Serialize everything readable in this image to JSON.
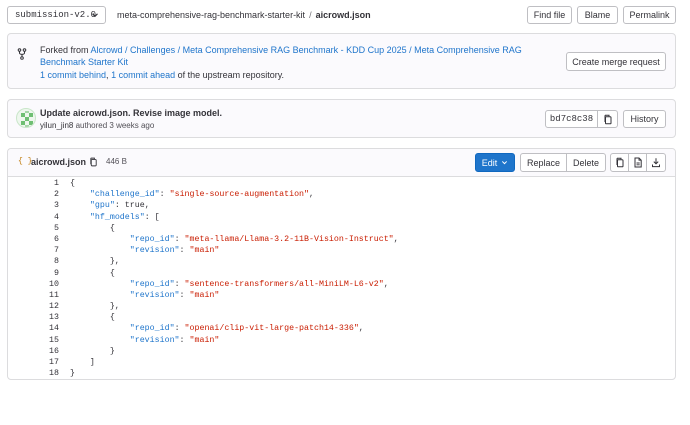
{
  "toolbar": {
    "branch": "submission-v2.0",
    "breadcrumb": {
      "repo": "meta-comprehensive-rag-benchmark-starter-kit",
      "separator": "/",
      "file": "aicrowd.json"
    },
    "find_file_label": "Find file",
    "blame_label": "Blame",
    "permalink_label": "Permalink"
  },
  "fork_notice": {
    "prefix": "Forked from",
    "source_link": "Alcrowd / Challenges / Meta Comprehensive RAG Benchmark - KDD Cup 2025 / Meta Comprehensive RAG Benchmark Starter Kit",
    "behind_link": "1 commit behind",
    "comma": ",",
    "ahead_link": "1 commit ahead",
    "suffix": "of the upstream repository.",
    "merge_button": "Create merge request"
  },
  "commit": {
    "title": "Update aicrowd.json. Revise image model.",
    "author": "yilun_jin8",
    "authored_text": "authored 3 weeks ago",
    "sha": "bd7c8c38",
    "history_label": "History"
  },
  "file": {
    "icon_text": "{ }",
    "name": "aicrowd.json",
    "size": "446 B",
    "edit_label": "Edit",
    "replace_label": "Replace",
    "delete_label": "Delete"
  },
  "code_lines": [
    {
      "n": "1",
      "t": [
        {
          "c": "p",
          "v": "{"
        }
      ]
    },
    {
      "n": "2",
      "t": [
        {
          "c": "p",
          "v": "    "
        },
        {
          "c": "k",
          "v": "\"challenge_id\""
        },
        {
          "c": "p",
          "v": ": "
        },
        {
          "c": "s",
          "v": "\"single-source-augmentation\""
        },
        {
          "c": "p",
          "v": ","
        }
      ]
    },
    {
      "n": "3",
      "t": [
        {
          "c": "p",
          "v": "    "
        },
        {
          "c": "k",
          "v": "\"gpu\""
        },
        {
          "c": "p",
          "v": ": true,"
        }
      ]
    },
    {
      "n": "4",
      "t": [
        {
          "c": "p",
          "v": "    "
        },
        {
          "c": "k",
          "v": "\"hf_models\""
        },
        {
          "c": "p",
          "v": ": ["
        }
      ]
    },
    {
      "n": "5",
      "t": [
        {
          "c": "p",
          "v": "        {"
        }
      ]
    },
    {
      "n": "6",
      "t": [
        {
          "c": "p",
          "v": "            "
        },
        {
          "c": "k",
          "v": "\"repo_id\""
        },
        {
          "c": "p",
          "v": ": "
        },
        {
          "c": "s",
          "v": "\"meta-llama/Llama-3.2-11B-Vision-Instruct\""
        },
        {
          "c": "p",
          "v": ","
        }
      ]
    },
    {
      "n": "7",
      "t": [
        {
          "c": "p",
          "v": "            "
        },
        {
          "c": "k",
          "v": "\"revision\""
        },
        {
          "c": "p",
          "v": ": "
        },
        {
          "c": "s",
          "v": "\"main\""
        }
      ]
    },
    {
      "n": "8",
      "t": [
        {
          "c": "p",
          "v": "        },"
        }
      ]
    },
    {
      "n": "9",
      "t": [
        {
          "c": "p",
          "v": "        {"
        }
      ]
    },
    {
      "n": "10",
      "t": [
        {
          "c": "p",
          "v": "            "
        },
        {
          "c": "k",
          "v": "\"repo_id\""
        },
        {
          "c": "p",
          "v": ": "
        },
        {
          "c": "s",
          "v": "\"sentence-transformers/all-MiniLM-L6-v2\""
        },
        {
          "c": "p",
          "v": ","
        }
      ]
    },
    {
      "n": "11",
      "t": [
        {
          "c": "p",
          "v": "            "
        },
        {
          "c": "k",
          "v": "\"revision\""
        },
        {
          "c": "p",
          "v": ": "
        },
        {
          "c": "s",
          "v": "\"main\""
        }
      ]
    },
    {
      "n": "12",
      "t": [
        {
          "c": "p",
          "v": "        },"
        }
      ]
    },
    {
      "n": "13",
      "t": [
        {
          "c": "p",
          "v": "        {"
        }
      ]
    },
    {
      "n": "14",
      "t": [
        {
          "c": "p",
          "v": "            "
        },
        {
          "c": "k",
          "v": "\"repo_id\""
        },
        {
          "c": "p",
          "v": ": "
        },
        {
          "c": "s",
          "v": "\"openai/clip-vit-large-patch14-336\""
        },
        {
          "c": "p",
          "v": ","
        }
      ]
    },
    {
      "n": "15",
      "t": [
        {
          "c": "p",
          "v": "            "
        },
        {
          "c": "k",
          "v": "\"revision\""
        },
        {
          "c": "p",
          "v": ": "
        },
        {
          "c": "s",
          "v": "\"main\""
        }
      ]
    },
    {
      "n": "16",
      "t": [
        {
          "c": "p",
          "v": "        }"
        }
      ]
    },
    {
      "n": "17",
      "t": [
        {
          "c": "p",
          "v": "    ]"
        }
      ]
    },
    {
      "n": "18",
      "t": [
        {
          "c": "p",
          "v": "}"
        }
      ]
    }
  ],
  "icons": {
    "branch_dropdown": "chevron-down-icon",
    "fork": "fork-icon",
    "copy_sha": "copy-icon",
    "copy_path": "copy-icon",
    "copy_contents": "copy-icon",
    "raw": "file-icon",
    "download": "download-icon"
  },
  "colors": {
    "primary": "#1f75cb",
    "string": "#c91c00",
    "text": "#333238",
    "border": "#dcdcde"
  }
}
